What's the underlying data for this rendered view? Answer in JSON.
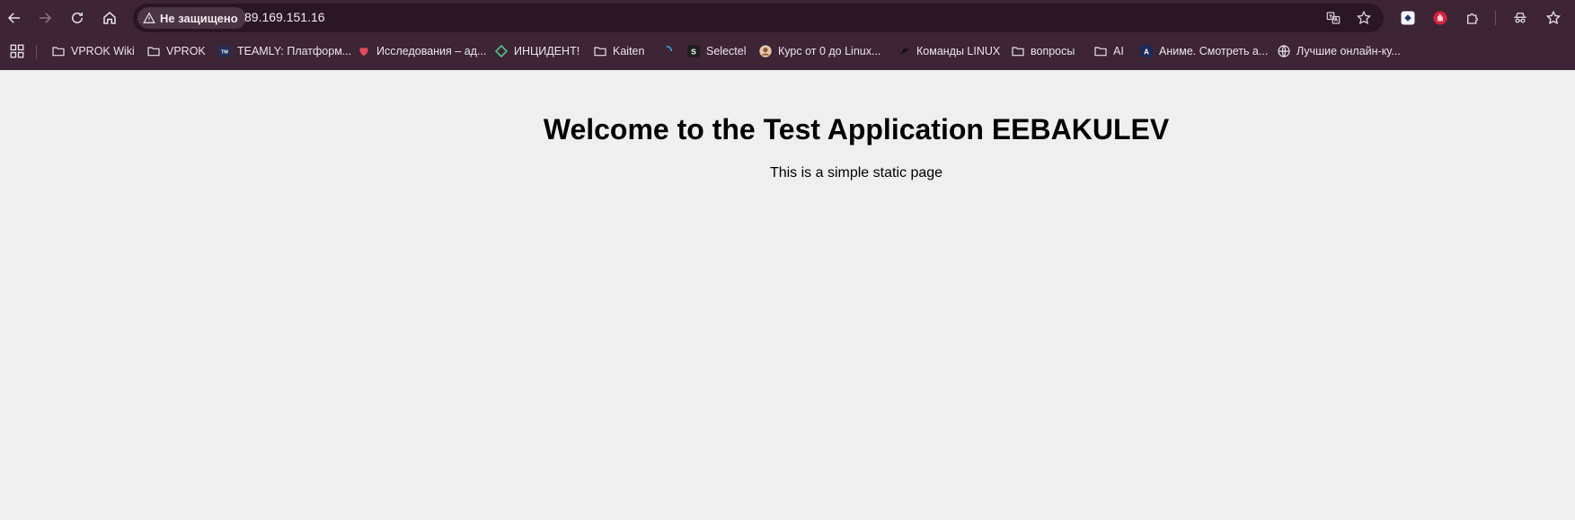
{
  "browser": {
    "security_label": "Не защищено",
    "url": "89.169.151.16",
    "icons": {
      "back": "arrow-left-icon",
      "forward": "arrow-right-icon",
      "reload": "reload-icon",
      "home": "home-icon",
      "warning": "warning-triangle-icon",
      "translate": "translate-icon",
      "bookmark_star": "star-icon",
      "extensions": "puzzle-icon",
      "incognito": "incognito-icon",
      "bookmarks_menu": "star-icon"
    },
    "colors": {
      "frame": "#3d2535",
      "omnibox": "#2a1624",
      "text": "#ece4ea"
    }
  },
  "bookmarks_bar": {
    "items": [
      {
        "label": "VPROK Wiki",
        "icon": "folder-icon"
      },
      {
        "label": "VPROK",
        "icon": "folder-icon"
      },
      {
        "label": "TEAMLY: Платформ...",
        "icon": "teamly-icon"
      },
      {
        "label": "Исследования – ад...",
        "icon": "heart-icon"
      },
      {
        "label": "ИНЦИДЕНТ!",
        "icon": "diamond-icon"
      },
      {
        "label": "Kaiten",
        "icon": "folder-icon"
      },
      {
        "label": "",
        "icon": "spinner-icon"
      },
      {
        "label": "Selectel",
        "icon": "selectel-icon"
      },
      {
        "label": "Курс от 0 до Linux...",
        "icon": "avatar-icon"
      },
      {
        "label": "Команды LINUX",
        "icon": "bird-icon"
      },
      {
        "label": "вопросы",
        "icon": "folder-icon"
      },
      {
        "label": "AI",
        "icon": "folder-icon"
      },
      {
        "label": "Аниме. Смотреть а...",
        "icon": "anime-icon"
      },
      {
        "label": "Лучшие онлайн-ку...",
        "icon": "globe-icon"
      }
    ]
  },
  "page": {
    "heading": "Welcome to the Test Application EEBAKULEV",
    "subtext": "This is a simple static page",
    "background": "#efefef"
  }
}
